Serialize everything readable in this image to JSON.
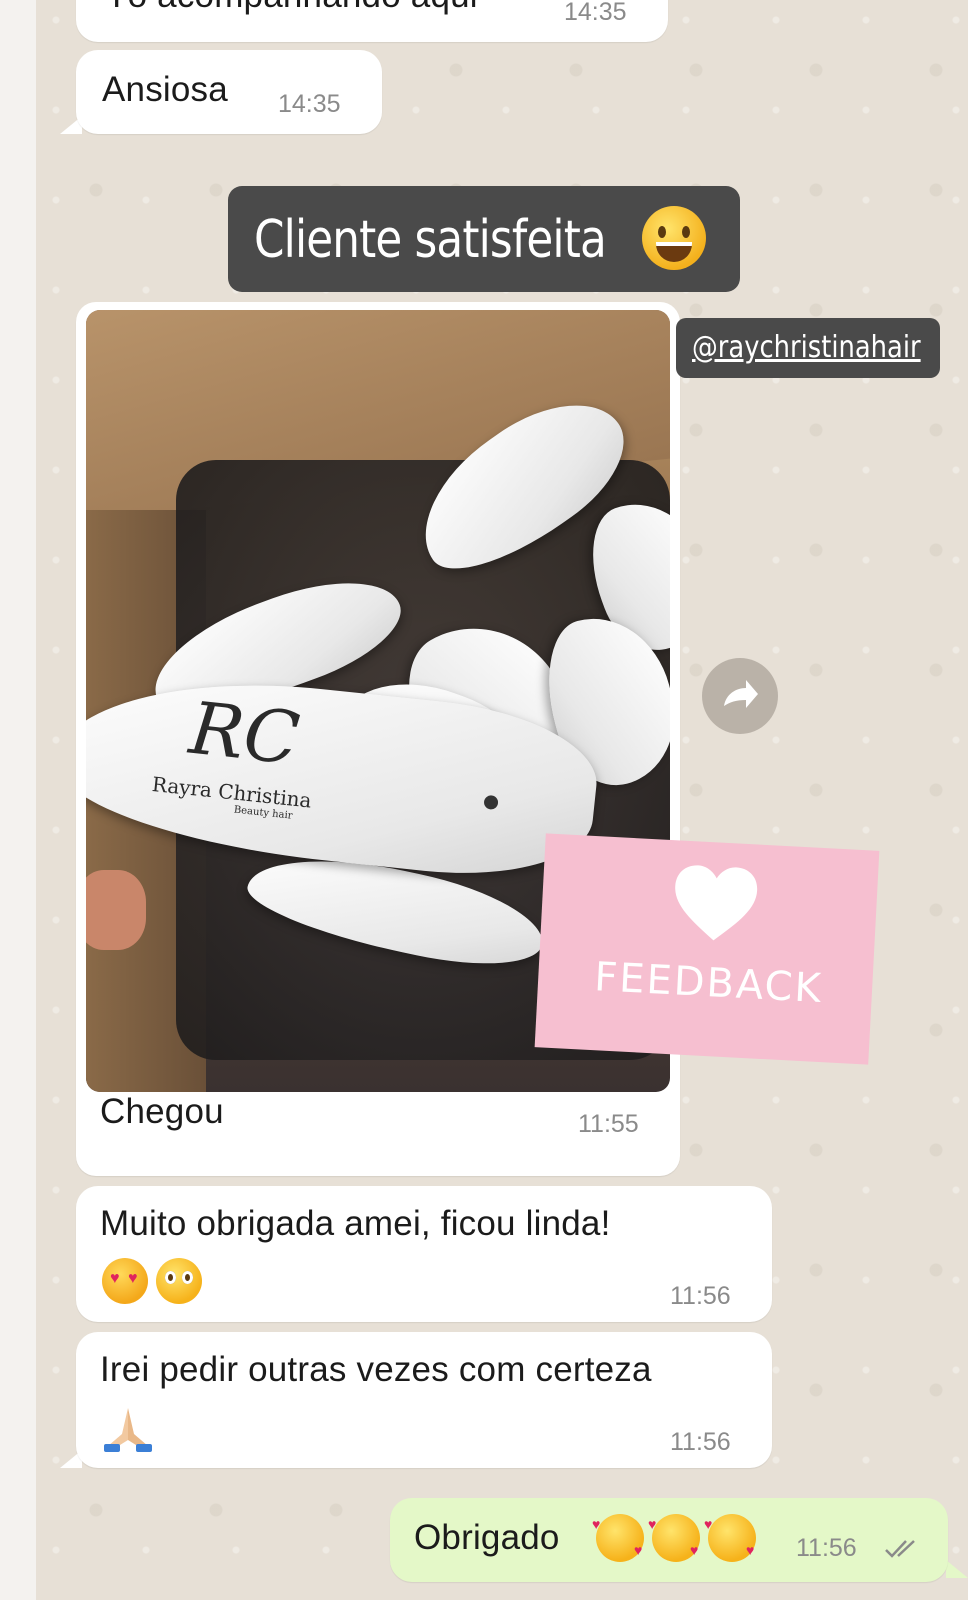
{
  "chat": {
    "messages": [
      {
        "text": "Tô acompanhando aqui",
        "time": "14:35"
      },
      {
        "text": "Ansiosa",
        "time": "14:35"
      },
      {
        "caption": "Chegou",
        "time": "11:55"
      },
      {
        "text": "Muito obrigada amei, ficou linda!",
        "time": "11:56"
      },
      {
        "text": "Irei pedir outras vezes com certeza",
        "time": "11:56"
      },
      {
        "text": "Obrigado",
        "time": "11:56",
        "status": "read"
      }
    ]
  },
  "overlay": {
    "headline": "Cliente satisfeita",
    "handle": "@raychristinahair",
    "sticker_text": "FEEDBACK"
  },
  "photo": {
    "brand_monogram": "RC",
    "brand_name": "Rayra Christina",
    "brand_sub": "Beauty hair"
  },
  "colors": {
    "incoming_bubble": "#ffffff",
    "outgoing_bubble": "#e4f8c8",
    "sticker_pink": "#f6bfd0",
    "overlay_dark": "#4a4a4a",
    "wallpaper": "#e7e0d6"
  },
  "icons": [
    "forward-icon",
    "heart-icon",
    "double-check-icon",
    "smiley-emoji",
    "heart-eyes-emoji",
    "pleading-emoji",
    "praying-hands-emoji",
    "smiling-hearts-emoji"
  ]
}
